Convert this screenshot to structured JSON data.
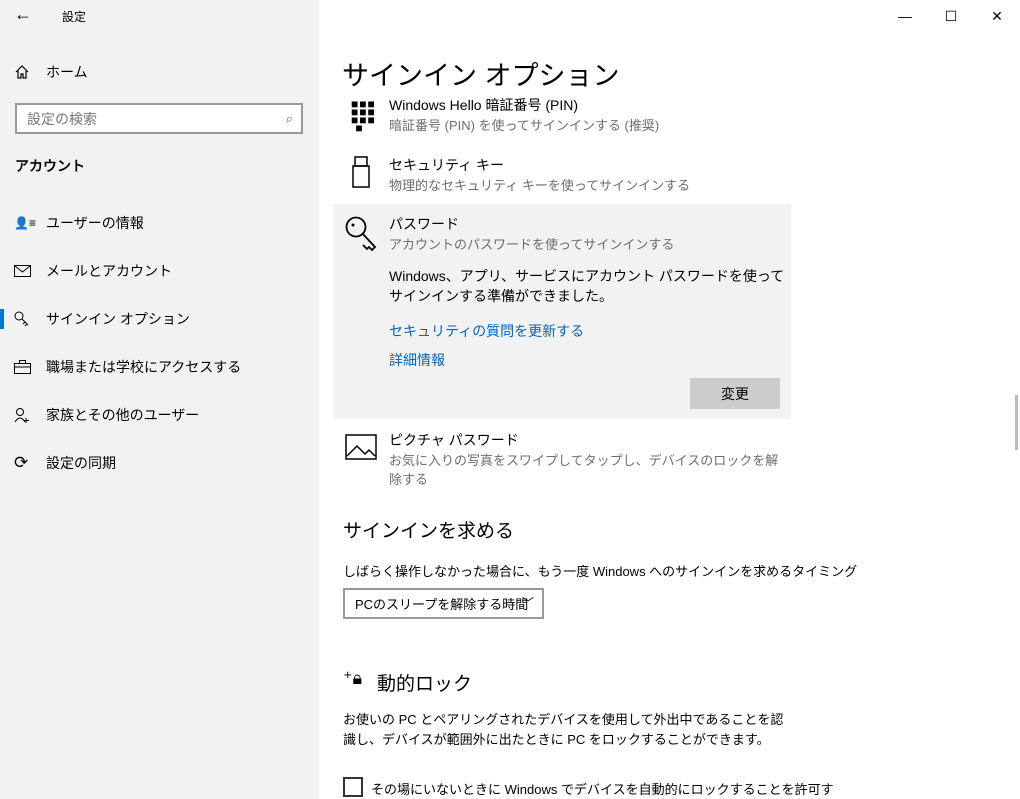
{
  "window": {
    "title": "設定",
    "back": "←",
    "minimize": "—",
    "maximize": "☐",
    "close": "✕"
  },
  "sidebar": {
    "home": "ホーム",
    "search_placeholder": "設定の検索",
    "section": "アカウント",
    "items": [
      {
        "label": "ユーザーの情報",
        "icon": "user-info-icon"
      },
      {
        "label": "メールとアカウント",
        "icon": "mail-icon"
      },
      {
        "label": "サインイン オプション",
        "icon": "key-icon",
        "selected": true
      },
      {
        "label": "職場または学校にアクセスする",
        "icon": "briefcase-icon"
      },
      {
        "label": "家族とその他のユーザー",
        "icon": "add-user-icon"
      },
      {
        "label": "設定の同期",
        "icon": "sync-icon"
      }
    ]
  },
  "main": {
    "title": "サインイン オプション",
    "options": [
      {
        "title": "Windows Hello 暗証番号 (PIN)",
        "sub": "暗証番号 (PIN) を使ってサインインする (推奨)"
      },
      {
        "title": "セキュリティ キー",
        "sub": "物理的なセキュリティ キーを使ってサインインする"
      },
      {
        "title": "パスワード",
        "sub": "アカウントのパスワードを使ってサインインする"
      },
      {
        "title": "ピクチャ パスワード",
        "sub": "お気に入りの写真をスワイプしてタップし、デバイスのロックを解除する"
      }
    ],
    "password": {
      "desc": "Windows、アプリ、サービスにアカウント パスワードを使ってサインインする準備ができました。",
      "link1": "セキュリティの質問を更新する",
      "link2": "詳細情報",
      "button": "変更"
    },
    "require": {
      "heading": "サインインを求める",
      "desc": "しばらく操作しなかった場合に、もう一度 Windows へのサインインを求めるタイミング",
      "select": "PCのスリープを解除する時間"
    },
    "dynamic": {
      "heading": "動的ロック",
      "desc": "お使いの PC とペアリングされたデバイスを使用して外出中であることを認識し、デバイスが範囲外に出たときに PC をロックすることができます。",
      "checkbox": "その場にいないときに Windows でデバイスを自動的にロックすることを許可す"
    }
  }
}
